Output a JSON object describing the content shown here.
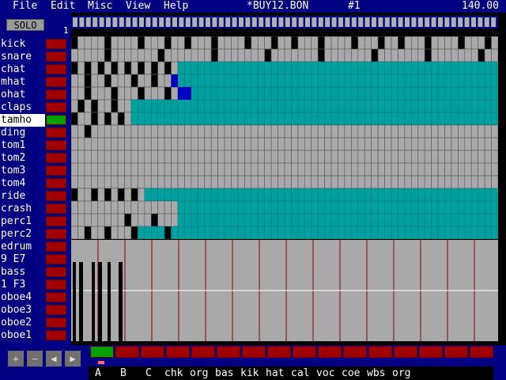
{
  "menu": [
    "File",
    "Edit",
    "Misc",
    "View",
    "Help"
  ],
  "song_file": "*BUY12.BON",
  "pattern_number": "#1",
  "tempo": "140.00",
  "solo_label": "SOLO",
  "bar_number": "1",
  "tracks": [
    "kick",
    "snare",
    "chat",
    "mhat",
    "ohat",
    "claps",
    "tamho",
    "ding",
    "tom1",
    "tom2",
    "tom3",
    "tom4",
    "ride",
    "crash",
    "perc1",
    "perc2",
    "edrum",
    "9 E7",
    "bass",
    "1 F3",
    "oboe4",
    "oboe3",
    "oboe2",
    "oboe1"
  ],
  "selected_track": "tamho",
  "nav_buttons": [
    "+",
    "–",
    "◀",
    "▶"
  ],
  "patterns": [
    "A",
    "B",
    "C",
    "chk",
    "org",
    "bas",
    "kik",
    "hat",
    "cal",
    "voc",
    "coe",
    "wbs",
    "org"
  ],
  "selected_pattern": "A",
  "colors": {
    "menu_bg": "#000080",
    "grid_gray": "#a9a9a9",
    "step_teal": "#00a0a0",
    "mute_red": "#a00000",
    "active_green": "#00a000",
    "cursor_blue": "#0000c0"
  }
}
